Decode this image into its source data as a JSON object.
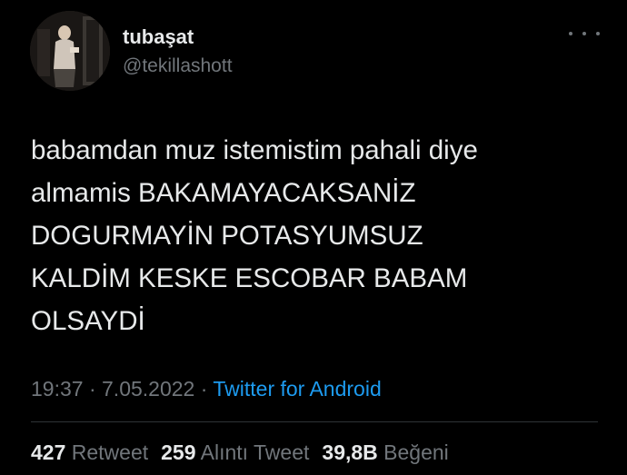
{
  "user": {
    "display_name": "tubaşat",
    "handle": "@tekillashott"
  },
  "tweet": {
    "text": "babamdan muz istemistim pahali diye\nalmamis BAKAMAYACAKSANİZ\nDOGURMAYİN POTASYUMSUZ\nKALDİM KESKE ESCOBAR BABAM\nOLSAYDİ",
    "time": "19:37",
    "date": "7.05.2022",
    "source": "Twitter for Android"
  },
  "stats": {
    "retweets": {
      "count": "427",
      "label": "Retweet"
    },
    "quotes": {
      "count": "259",
      "label": "Alıntı Tweet"
    },
    "likes": {
      "count": "39,8B",
      "label": "Beğeni"
    }
  },
  "icons": {
    "more": "more-horizontal-icon"
  },
  "colors": {
    "background": "#000000",
    "text": "#e7e9ea",
    "muted": "#71767b",
    "link": "#1d9bf0",
    "divider": "#2f3336"
  }
}
